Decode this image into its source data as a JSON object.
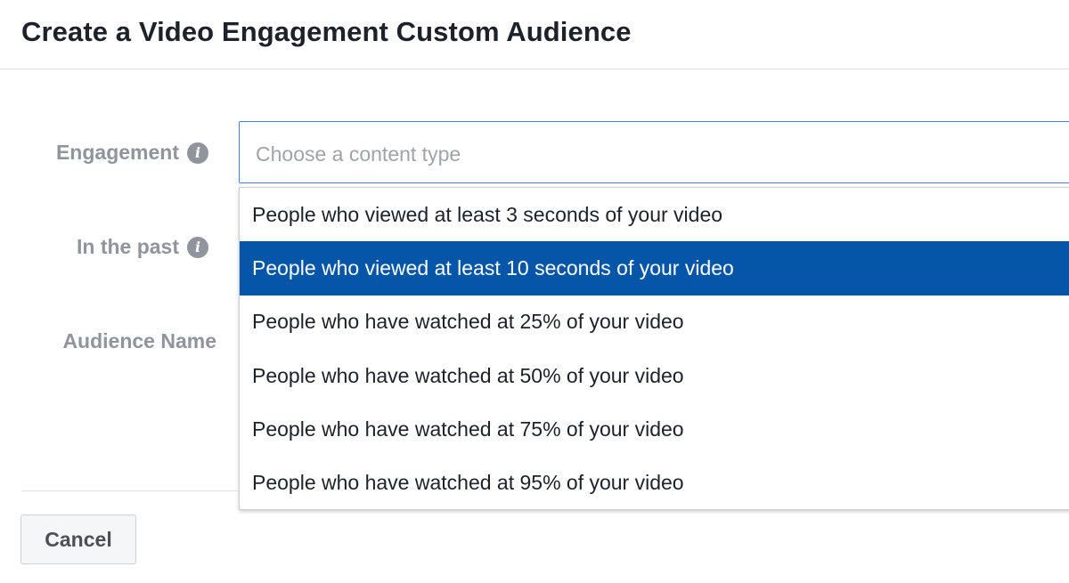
{
  "dialog": {
    "title": "Create a Video Engagement Custom Audience"
  },
  "form": {
    "engagement_label": "Engagement",
    "past_label": "In the past",
    "audience_name_label": "Audience Name",
    "info_icon": "info-icon",
    "select_placeholder": "Choose a content type"
  },
  "dropdown": {
    "selected_index": 1,
    "items": [
      {
        "label": "People who viewed at least 3 seconds of your video"
      },
      {
        "label": "People who viewed at least 10 seconds of your video"
      },
      {
        "label": "People who have watched at 25% of your video"
      },
      {
        "label": "People who have watched at 50% of your video"
      },
      {
        "label": "People who have watched at 75% of your video"
      },
      {
        "label": "People who have watched at 95% of your video"
      }
    ]
  },
  "footer": {
    "cancel_label": "Cancel"
  },
  "colors": {
    "accent_blue": "#0556a8",
    "focus_border": "#4080ff",
    "label_gray": "#90949c"
  }
}
